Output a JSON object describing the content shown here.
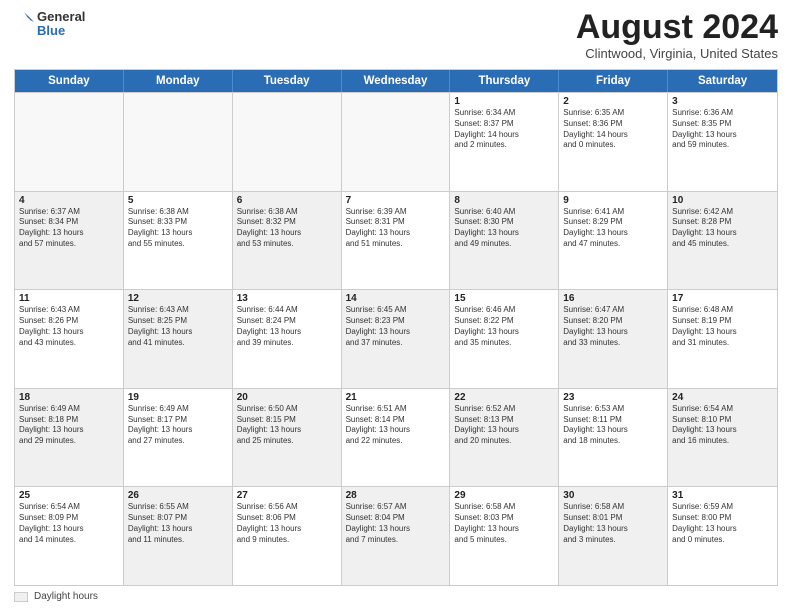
{
  "logo": {
    "general": "General",
    "blue": "Blue"
  },
  "title": {
    "month_year": "August 2024",
    "location": "Clintwood, Virginia, United States"
  },
  "calendar": {
    "headers": [
      "Sunday",
      "Monday",
      "Tuesday",
      "Wednesday",
      "Thursday",
      "Friday",
      "Saturday"
    ],
    "legend_label": "Daylight hours",
    "weeks": [
      {
        "shaded": [
          false,
          false,
          false,
          false,
          false,
          false,
          false
        ],
        "cells": [
          {
            "day": "",
            "text": ""
          },
          {
            "day": "",
            "text": ""
          },
          {
            "day": "",
            "text": ""
          },
          {
            "day": "",
            "text": ""
          },
          {
            "day": "1",
            "text": "Sunrise: 6:34 AM\nSunset: 8:37 PM\nDaylight: 14 hours\nand 2 minutes."
          },
          {
            "day": "2",
            "text": "Sunrise: 6:35 AM\nSunset: 8:36 PM\nDaylight: 14 hours\nand 0 minutes."
          },
          {
            "day": "3",
            "text": "Sunrise: 6:36 AM\nSunset: 8:35 PM\nDaylight: 13 hours\nand 59 minutes."
          }
        ]
      },
      {
        "shaded": [
          true,
          false,
          true,
          false,
          true,
          false,
          true
        ],
        "cells": [
          {
            "day": "4",
            "text": "Sunrise: 6:37 AM\nSunset: 8:34 PM\nDaylight: 13 hours\nand 57 minutes."
          },
          {
            "day": "5",
            "text": "Sunrise: 6:38 AM\nSunset: 8:33 PM\nDaylight: 13 hours\nand 55 minutes."
          },
          {
            "day": "6",
            "text": "Sunrise: 6:38 AM\nSunset: 8:32 PM\nDaylight: 13 hours\nand 53 minutes."
          },
          {
            "day": "7",
            "text": "Sunrise: 6:39 AM\nSunset: 8:31 PM\nDaylight: 13 hours\nand 51 minutes."
          },
          {
            "day": "8",
            "text": "Sunrise: 6:40 AM\nSunset: 8:30 PM\nDaylight: 13 hours\nand 49 minutes."
          },
          {
            "day": "9",
            "text": "Sunrise: 6:41 AM\nSunset: 8:29 PM\nDaylight: 13 hours\nand 47 minutes."
          },
          {
            "day": "10",
            "text": "Sunrise: 6:42 AM\nSunset: 8:28 PM\nDaylight: 13 hours\nand 45 minutes."
          }
        ]
      },
      {
        "shaded": [
          false,
          true,
          false,
          true,
          false,
          true,
          false
        ],
        "cells": [
          {
            "day": "11",
            "text": "Sunrise: 6:43 AM\nSunset: 8:26 PM\nDaylight: 13 hours\nand 43 minutes."
          },
          {
            "day": "12",
            "text": "Sunrise: 6:43 AM\nSunset: 8:25 PM\nDaylight: 13 hours\nand 41 minutes."
          },
          {
            "day": "13",
            "text": "Sunrise: 6:44 AM\nSunset: 8:24 PM\nDaylight: 13 hours\nand 39 minutes."
          },
          {
            "day": "14",
            "text": "Sunrise: 6:45 AM\nSunset: 8:23 PM\nDaylight: 13 hours\nand 37 minutes."
          },
          {
            "day": "15",
            "text": "Sunrise: 6:46 AM\nSunset: 8:22 PM\nDaylight: 13 hours\nand 35 minutes."
          },
          {
            "day": "16",
            "text": "Sunrise: 6:47 AM\nSunset: 8:20 PM\nDaylight: 13 hours\nand 33 minutes."
          },
          {
            "day": "17",
            "text": "Sunrise: 6:48 AM\nSunset: 8:19 PM\nDaylight: 13 hours\nand 31 minutes."
          }
        ]
      },
      {
        "shaded": [
          true,
          false,
          true,
          false,
          true,
          false,
          true
        ],
        "cells": [
          {
            "day": "18",
            "text": "Sunrise: 6:49 AM\nSunset: 8:18 PM\nDaylight: 13 hours\nand 29 minutes."
          },
          {
            "day": "19",
            "text": "Sunrise: 6:49 AM\nSunset: 8:17 PM\nDaylight: 13 hours\nand 27 minutes."
          },
          {
            "day": "20",
            "text": "Sunrise: 6:50 AM\nSunset: 8:15 PM\nDaylight: 13 hours\nand 25 minutes."
          },
          {
            "day": "21",
            "text": "Sunrise: 6:51 AM\nSunset: 8:14 PM\nDaylight: 13 hours\nand 22 minutes."
          },
          {
            "day": "22",
            "text": "Sunrise: 6:52 AM\nSunset: 8:13 PM\nDaylight: 13 hours\nand 20 minutes."
          },
          {
            "day": "23",
            "text": "Sunrise: 6:53 AM\nSunset: 8:11 PM\nDaylight: 13 hours\nand 18 minutes."
          },
          {
            "day": "24",
            "text": "Sunrise: 6:54 AM\nSunset: 8:10 PM\nDaylight: 13 hours\nand 16 minutes."
          }
        ]
      },
      {
        "shaded": [
          false,
          true,
          false,
          true,
          false,
          true,
          false
        ],
        "cells": [
          {
            "day": "25",
            "text": "Sunrise: 6:54 AM\nSunset: 8:09 PM\nDaylight: 13 hours\nand 14 minutes."
          },
          {
            "day": "26",
            "text": "Sunrise: 6:55 AM\nSunset: 8:07 PM\nDaylight: 13 hours\nand 11 minutes."
          },
          {
            "day": "27",
            "text": "Sunrise: 6:56 AM\nSunset: 8:06 PM\nDaylight: 13 hours\nand 9 minutes."
          },
          {
            "day": "28",
            "text": "Sunrise: 6:57 AM\nSunset: 8:04 PM\nDaylight: 13 hours\nand 7 minutes."
          },
          {
            "day": "29",
            "text": "Sunrise: 6:58 AM\nSunset: 8:03 PM\nDaylight: 13 hours\nand 5 minutes."
          },
          {
            "day": "30",
            "text": "Sunrise: 6:58 AM\nSunset: 8:01 PM\nDaylight: 13 hours\nand 3 minutes."
          },
          {
            "day": "31",
            "text": "Sunrise: 6:59 AM\nSunset: 8:00 PM\nDaylight: 13 hours\nand 0 minutes."
          }
        ]
      }
    ]
  }
}
